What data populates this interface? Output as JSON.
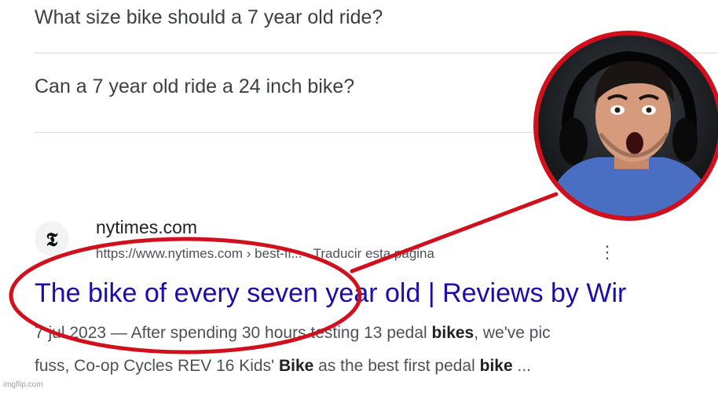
{
  "questions": [
    "What size bike should a 7 year old ride?",
    "Can a 7 year old ride a 24 inch bike?"
  ],
  "result": {
    "favicon_letter": "𝕿",
    "site": "nytimes.com",
    "url": "https://www.nytimes.com › best-fi...",
    "translate": "Traducir esta página",
    "title": "The bike of every seven year old | Reviews by Wir",
    "date": "7 jul 2023",
    "snippet_line1_a": "— After spending 30 hours testing 13 pedal ",
    "snippet_line1_b": "bikes",
    "snippet_line1_c": ", we've pic",
    "snippet_line2_a": "fuss, Co-op Cycles REV 16 Kids' ",
    "snippet_line2_b": "Bike",
    "snippet_line2_c": " as the best first pedal ",
    "snippet_line2_d": "bike",
    "snippet_line2_e": " ..."
  },
  "overlay": {
    "color": "#d0101c"
  },
  "watermark": "imgflip.com"
}
